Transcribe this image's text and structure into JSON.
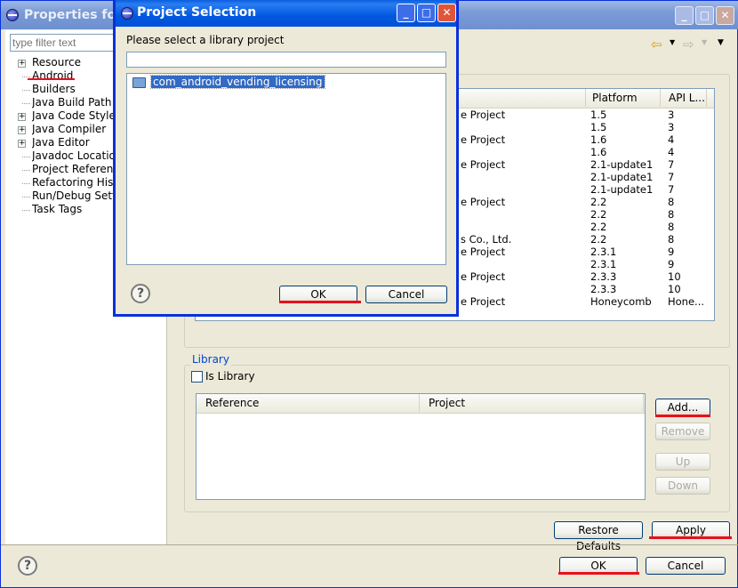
{
  "main_window": {
    "title": "Properties for",
    "filter_placeholder": "type filter text",
    "tree": [
      {
        "label": "Resource",
        "expandable": true
      },
      {
        "label": "Android",
        "expandable": false
      },
      {
        "label": "Builders",
        "expandable": false
      },
      {
        "label": "Java Build Path",
        "expandable": false
      },
      {
        "label": "Java Code Style",
        "expandable": true
      },
      {
        "label": "Java Compiler",
        "expandable": true
      },
      {
        "label": "Java Editor",
        "expandable": true
      },
      {
        "label": "Javadoc Location",
        "expandable": false
      },
      {
        "label": "Project References",
        "expandable": false
      },
      {
        "label": "Refactoring History",
        "expandable": false
      },
      {
        "label": "Run/Debug Settings",
        "expandable": false
      },
      {
        "label": "Task Tags",
        "expandable": false
      }
    ],
    "target_table": {
      "columns": [
        "Platform",
        "API L..."
      ],
      "rows": [
        {
          "vendor": "e Project",
          "platform": "1.5",
          "api": "3"
        },
        {
          "vendor": "",
          "platform": "1.5",
          "api": "3"
        },
        {
          "vendor": "e Project",
          "platform": "1.6",
          "api": "4"
        },
        {
          "vendor": "",
          "platform": "1.6",
          "api": "4"
        },
        {
          "vendor": "e Project",
          "platform": "2.1-update1",
          "api": "7"
        },
        {
          "vendor": "",
          "platform": "2.1-update1",
          "api": "7"
        },
        {
          "vendor": "",
          "platform": "2.1-update1",
          "api": "7"
        },
        {
          "vendor": "e Project",
          "platform": "2.2",
          "api": "8"
        },
        {
          "vendor": "",
          "platform": "2.2",
          "api": "8"
        },
        {
          "vendor": "",
          "platform": "2.2",
          "api": "8"
        },
        {
          "vendor": "s Co., Ltd.",
          "platform": "2.2",
          "api": "8"
        },
        {
          "vendor": "e Project",
          "platform": "2.3.1",
          "api": "9"
        },
        {
          "vendor": "",
          "platform": "2.3.1",
          "api": "9"
        },
        {
          "vendor": "e Project",
          "platform": "2.3.3",
          "api": "10"
        },
        {
          "vendor": "",
          "platform": "2.3.3",
          "api": "10"
        },
        {
          "vendor": "e Project",
          "platform": "Honeycomb",
          "api": "Hone..."
        }
      ]
    },
    "library": {
      "group_label": "Library",
      "is_library_label": "Is Library",
      "columns": [
        "Reference",
        "Project"
      ],
      "buttons": {
        "add": "Add...",
        "remove": "Remove",
        "up": "Up",
        "down": "Down"
      }
    },
    "restore_defaults": "Restore Defaults",
    "apply": "Apply",
    "ok": "OK",
    "cancel": "Cancel"
  },
  "dialog": {
    "title": "Project Selection",
    "prompt": "Please select a library project",
    "filter_value": "",
    "projects": [
      "com_android_vending_licensing"
    ],
    "ok": "OK",
    "cancel": "Cancel"
  },
  "colors": {
    "highlight": "#e8101c",
    "selection": "#316ac5",
    "titlebar_active": "#0058e0"
  }
}
